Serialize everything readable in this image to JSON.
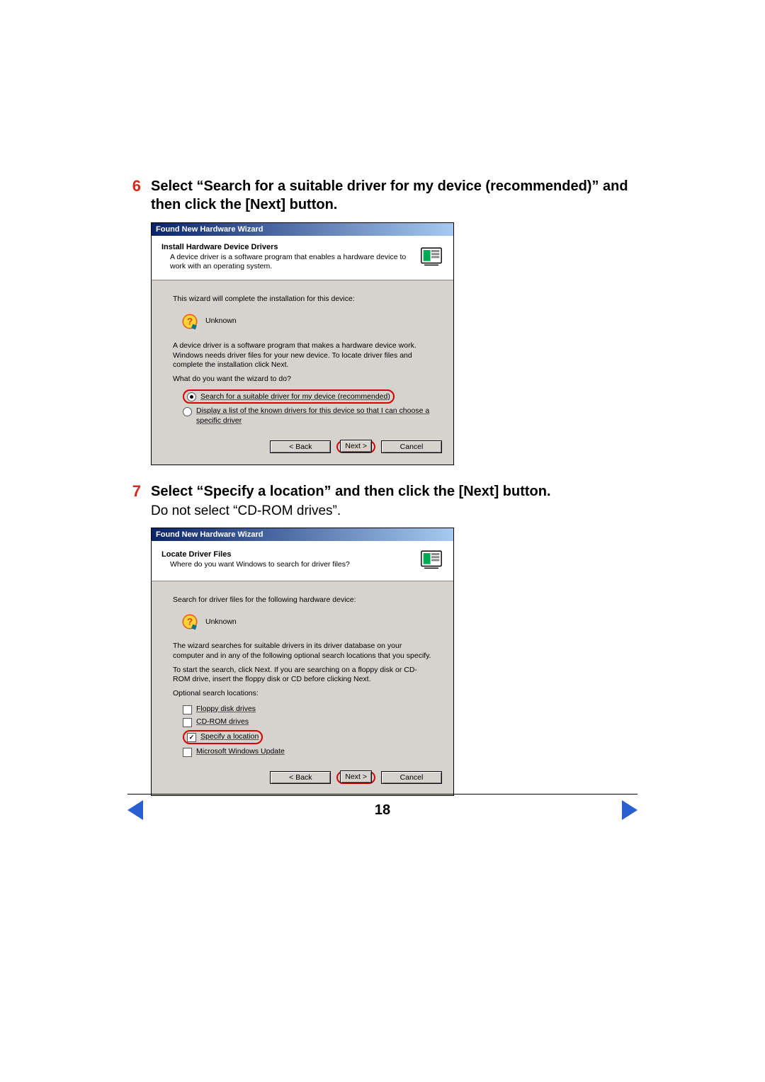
{
  "steps": {
    "s6": {
      "num": "6",
      "title": "Select “Search for a suitable driver for my device (recommended)” and then click the [Next] button."
    },
    "s7": {
      "num": "7",
      "title": "Select “Specify a location” and then click the [Next] button.",
      "note": "Do not select “CD-ROM drives”."
    }
  },
  "dialog1": {
    "title": "Found New Hardware Wizard",
    "header_title": "Install Hardware Device Drivers",
    "header_sub": "A device driver is a software program that enables a hardware device to work with an operating system.",
    "body_intro": "This wizard will complete the installation for this device:",
    "device_name": "Unknown",
    "body_desc": "A device driver is a software program that makes a hardware device work. Windows needs driver files for your new device. To locate driver files and complete the installation click Next.",
    "question": "What do you want the wizard to do?",
    "opt1": "Search for a suitable driver for my device (recommended)",
    "opt2": "Display a list of the known drivers for this device so that I can choose a specific driver",
    "back": "< Back",
    "next": "Next >",
    "cancel": "Cancel"
  },
  "dialog2": {
    "title": "Found New Hardware Wizard",
    "header_title": "Locate Driver Files",
    "header_sub": "Where do you want Windows to search for driver files?",
    "body_intro": "Search for driver files for the following hardware device:",
    "device_name": "Unknown",
    "body_desc1": "The wizard searches for suitable drivers in its driver database on your computer and in any of the following optional search locations that you specify.",
    "body_desc2": "To start the search, click Next. If you are searching on a floppy disk or CD-ROM drive, insert the floppy disk or CD before clicking Next.",
    "opt_heading": "Optional search locations:",
    "opt_floppy": "Floppy disk drives",
    "opt_cdrom": "CD-ROM drives",
    "opt_specify": "Specify a location",
    "opt_winupdate": "Microsoft Windows Update",
    "back": "< Back",
    "next": "Next >",
    "cancel": "Cancel"
  },
  "footer": {
    "page_number": "18"
  }
}
